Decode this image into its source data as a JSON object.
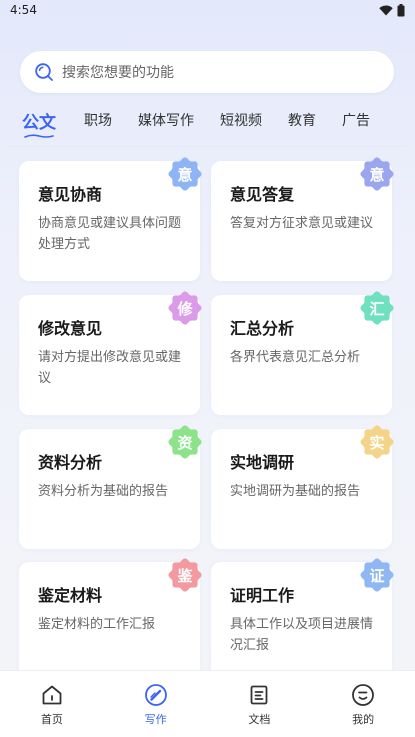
{
  "status_bar": {
    "time": "4:54"
  },
  "search": {
    "placeholder": "搜索您想要的功能"
  },
  "tabs": [
    {
      "label": "公文",
      "active": true
    },
    {
      "label": "职场"
    },
    {
      "label": "媒体写作"
    },
    {
      "label": "短视频"
    },
    {
      "label": "教育"
    },
    {
      "label": "广告"
    }
  ],
  "cards": [
    {
      "title": "意见协商",
      "desc": "协商意见或建议具体问题处理方式",
      "badge": "意",
      "badge_color": "#8fb4f5"
    },
    {
      "title": "意见答复",
      "desc": "答复对方征求意见或建议",
      "badge": "意",
      "badge_color": "#9aa6ee"
    },
    {
      "title": "修改意见",
      "desc": "请对方提出修改意见或建议",
      "badge": "修",
      "badge_color": "#dc9be9"
    },
    {
      "title": "汇总分析",
      "desc": "各界代表意见汇总分析",
      "badge": "汇",
      "badge_color": "#6fe0c0"
    },
    {
      "title": "资料分析",
      "desc": "资料分析为基础的报告",
      "badge": "资",
      "badge_color": "#8de38a"
    },
    {
      "title": "实地调研",
      "desc": "实地调研为基础的报告",
      "badge": "实",
      "badge_color": "#f3d489"
    },
    {
      "title": "鉴定材料",
      "desc": "鉴定材料的工作汇报",
      "badge": "鉴",
      "badge_color": "#f29aa0"
    },
    {
      "title": "证明工作",
      "desc": "具体工作以及项目进展情况汇报",
      "badge": "证",
      "badge_color": "#8fb8f2"
    }
  ],
  "bottom_nav": [
    {
      "label": "首页",
      "icon": "home-icon"
    },
    {
      "label": "写作",
      "icon": "write-icon",
      "active": true
    },
    {
      "label": "文档",
      "icon": "document-icon"
    },
    {
      "label": "我的",
      "icon": "profile-icon"
    }
  ],
  "colors": {
    "accent": "#3b64f5"
  }
}
